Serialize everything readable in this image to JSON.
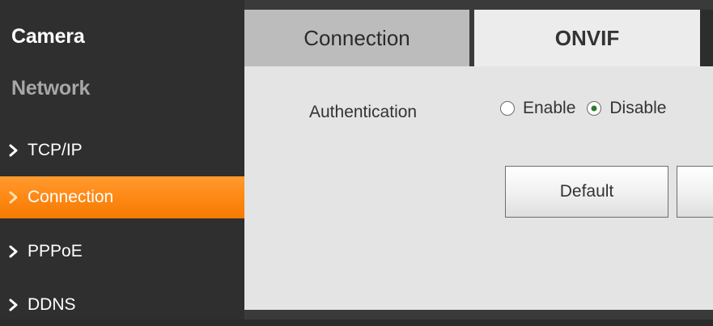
{
  "sidebar": {
    "headings": {
      "camera": "Camera",
      "network": "Network"
    },
    "items": [
      {
        "label": "TCP/IP",
        "active": false
      },
      {
        "label": "Connection",
        "active": true
      },
      {
        "label": "PPPoE",
        "active": false
      },
      {
        "label": "DDNS",
        "active": false
      }
    ]
  },
  "tabs": [
    {
      "label": "Connection",
      "active": false
    },
    {
      "label": "ONVIF",
      "active": true
    }
  ],
  "onvif": {
    "authentication_label": "Authentication",
    "options": [
      {
        "label": "Enable",
        "checked": false
      },
      {
        "label": "Disable",
        "checked": true
      }
    ],
    "buttons": {
      "default_label": "Default",
      "partial_label": ""
    }
  },
  "colors": {
    "sidebar_bg": "#2f2f2f",
    "active_item": "#ff8c1a",
    "tab_active_bg": "#ececec",
    "tab_inactive_bg": "#bcbcbc",
    "panel_bg": "#e4e4e4",
    "radio_checked": "#2d7a2d"
  }
}
